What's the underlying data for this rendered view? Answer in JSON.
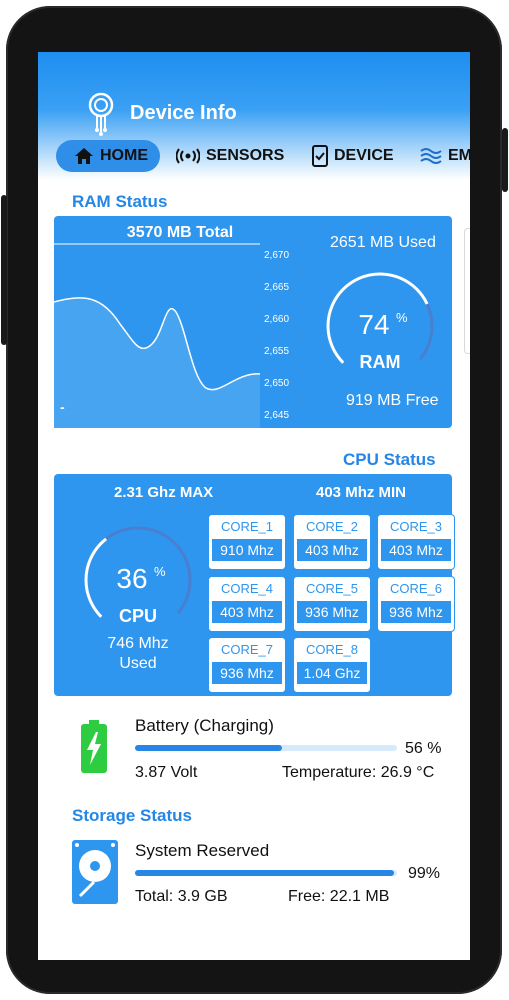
{
  "header": {
    "title": "Device Info"
  },
  "tabs": [
    {
      "label": "HOME",
      "icon": "home-icon",
      "active": true
    },
    {
      "label": "SENSORS",
      "icon": "broadcast-icon",
      "active": false
    },
    {
      "label": "DEVICE",
      "icon": "device-check-icon",
      "active": false
    },
    {
      "label": "EM",
      "icon": "waves-icon",
      "active": false
    }
  ],
  "ram": {
    "title": "RAM Status",
    "total": "3570 MB Total",
    "used": "2651 MB Used",
    "free": "919 MB Free",
    "percent": 74,
    "percent_text": "74",
    "percent_sign": "%",
    "gauge_label": "RAM",
    "ticks": [
      "2,670",
      "2,665",
      "2,660",
      "2,655",
      "2,650",
      "2,645"
    ],
    "marker": "-"
  },
  "cpu": {
    "title": "CPU Status",
    "max": "2.31 Ghz MAX",
    "min": "403 Mhz MIN",
    "percent": 36,
    "percent_text": "36",
    "percent_sign": "%",
    "gauge_label": "CPU",
    "used_line1": "746 Mhz",
    "used_line2": "Used",
    "cores": [
      {
        "name": "CORE_1",
        "value": "910 Mhz"
      },
      {
        "name": "CORE_2",
        "value": "403 Mhz"
      },
      {
        "name": "CORE_3",
        "value": "403 Mhz"
      },
      {
        "name": "CORE_4",
        "value": "403 Mhz"
      },
      {
        "name": "CORE_5",
        "value": "936 Mhz"
      },
      {
        "name": "CORE_6",
        "value": "936 Mhz"
      },
      {
        "name": "CORE_7",
        "value": "936 Mhz"
      },
      {
        "name": "CORE_8",
        "value": "1.04 Ghz"
      }
    ]
  },
  "battery": {
    "label": "Battery (Charging)",
    "percent": 56,
    "percent_text": "56 %",
    "voltage": "3.87 Volt",
    "temperature": "Temperature: 26.9 °C"
  },
  "storage": {
    "title": "Storage Status",
    "label": "System Reserved",
    "percent": 99,
    "percent_text": "99%",
    "total": "Total: 3.9 GB",
    "free": "Free: 22.1 MB"
  },
  "colors": {
    "accent": "#2e96ee",
    "title_blue": "#2586e6",
    "battery_green": "#2ecc40"
  }
}
